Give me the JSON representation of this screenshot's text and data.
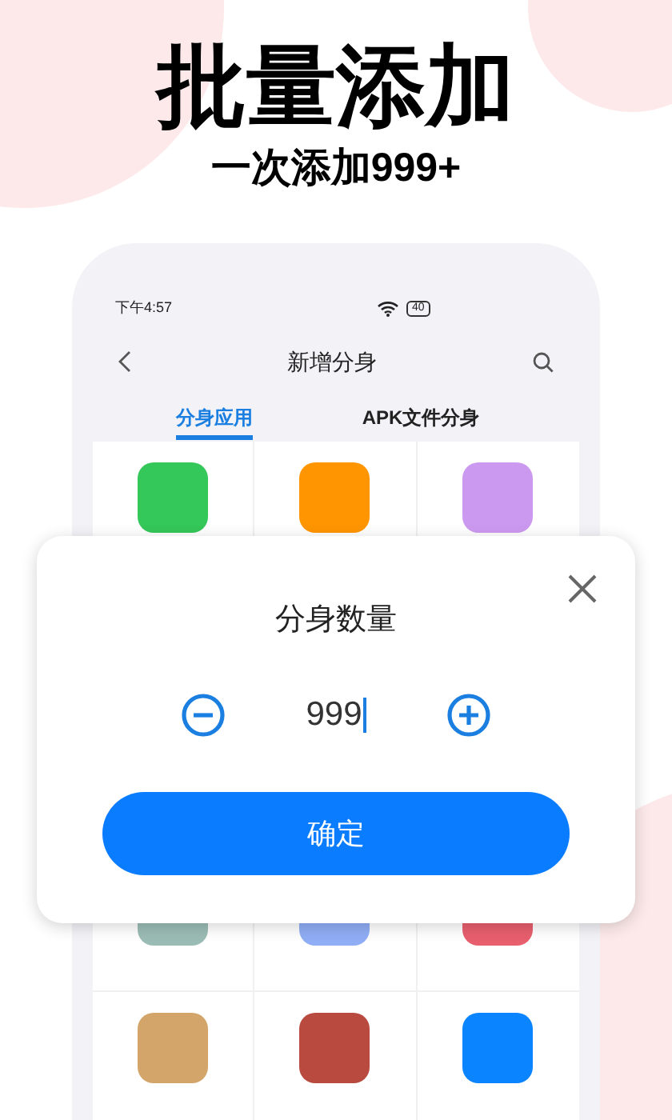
{
  "headline": "批量添加",
  "subheadline": "一次添加999+",
  "phone": {
    "status_bar": {
      "time": "下午4:57",
      "battery": "40"
    },
    "nav": {
      "title": "新增分身"
    },
    "tabs": [
      {
        "label": "分身应用",
        "selected": true
      },
      {
        "label": "APK文件分身",
        "selected": false
      }
    ],
    "app_rows": [
      {
        "tiles": [
          {
            "color": "#34c759"
          },
          {
            "color": "#ff9500"
          },
          {
            "color": "#cc99f0"
          }
        ]
      },
      {
        "tiles": [
          {
            "color": "#9bbcb5"
          },
          {
            "color": "#90aef5"
          },
          {
            "color": "#e85f6e"
          }
        ]
      },
      {
        "tiles": [
          {
            "color": "#d4a56a"
          },
          {
            "color": "#b84a40"
          },
          {
            "color": "#0a84ff"
          }
        ]
      }
    ]
  },
  "dialog": {
    "title": "分身数量",
    "value": "999",
    "confirm": "确定"
  }
}
